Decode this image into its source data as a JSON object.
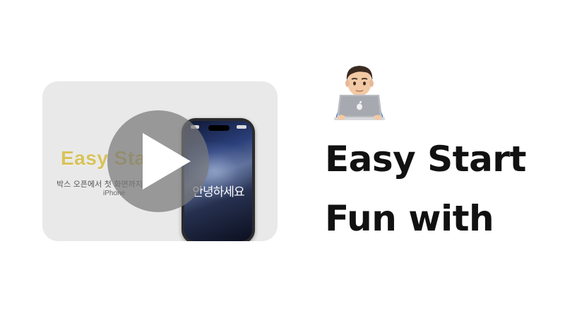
{
  "video": {
    "title": "Easy Start",
    "subtitle": "박스 오픈에서 첫 화면까지",
    "device": "iPhone",
    "screen_text": "안녕하세요",
    "play_icon": "play-icon"
  },
  "emoji": {
    "icon": "technologist-laptop-icon"
  },
  "headline": {
    "line1": "Easy Start",
    "line2": "Fun with"
  },
  "colors": {
    "card_background": "#e9e9e9",
    "thumb_title": "#d8c35a",
    "play_overlay": "#787878",
    "headline": "#111111"
  }
}
